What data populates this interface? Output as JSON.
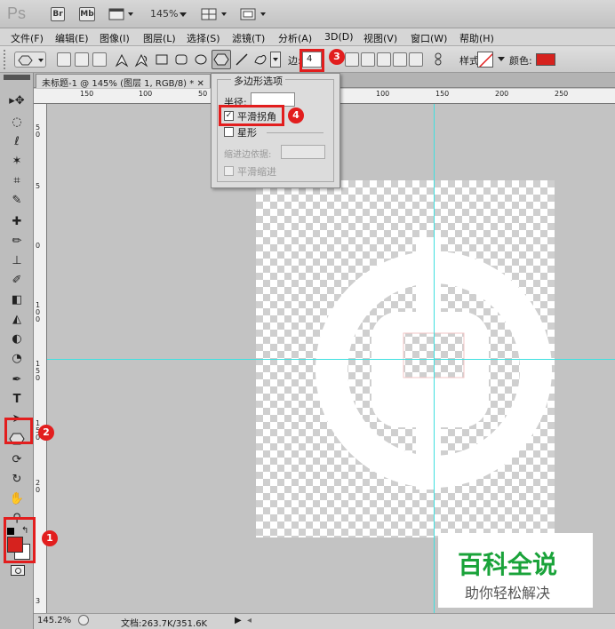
{
  "app": {
    "logo": "Ps",
    "br_label": "Br",
    "mb_label": "Mb",
    "zoom": "145%"
  },
  "menu": [
    "文件(F)",
    "编辑(E)",
    "图像(I)",
    "图层(L)",
    "选择(S)",
    "滤镜(T)",
    "分析(A)",
    "3D(D)",
    "视图(V)",
    "窗口(W)",
    "帮助(H)"
  ],
  "options": {
    "sides_label": "边:",
    "sides_value": "4",
    "style_label": "样式:",
    "color_label": "颜色:",
    "color": "#d6221e"
  },
  "document": {
    "tab_title": "未标题-1 @ 145% (图层 1, RGB/8) *"
  },
  "ruler": {
    "top_labels": [
      "150",
      "100",
      "50",
      "100",
      "150",
      "200",
      "250"
    ],
    "left_labels": [
      "5",
      "0",
      "5",
      "0",
      "1",
      "0",
      "0",
      "1",
      "5",
      "0",
      "1",
      "5",
      "0",
      "2",
      "0",
      "3"
    ]
  },
  "popup": {
    "title": "多边形选项",
    "radius_label": "半径:",
    "smooth_corners_label": "平滑拐角",
    "smooth_corners_checked": true,
    "star_label": "星形",
    "indent_label": "缩进边依据:",
    "smooth_indents_label": "平滑缩进"
  },
  "badges": [
    "1",
    "2",
    "3",
    "4"
  ],
  "status": {
    "zoom": "145.2%",
    "doc_info": "文档:263.7K/351.6K"
  },
  "watermark": {
    "line1": "百科全说",
    "line2": "助你轻松解决",
    "color": "#1aa33a"
  },
  "colors": {
    "highlight": "#e21e1e",
    "guide": "#3fe0e0",
    "foreground": "#d6221e",
    "background": "#ffffff"
  }
}
